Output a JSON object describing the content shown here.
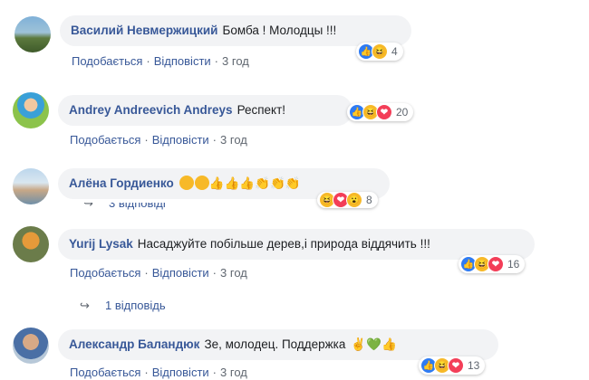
{
  "comments": [
    {
      "author": "Василий Невмержицкий",
      "text": "Бомба ! Молодцы !!!",
      "reaction_count": "4",
      "like_label": "Подобається",
      "reply_label": "Відповісти",
      "time": "3 год",
      "reactions": [
        "like",
        "haha"
      ]
    },
    {
      "author": "Andrey Andreevich Andreys",
      "text": "Респект!",
      "reaction_count": "20",
      "like_label": "Подобається",
      "reply_label": "Відповісти",
      "time": "3 год",
      "reactions": [
        "like",
        "haha",
        "love"
      ]
    },
    {
      "author": "Алёна Гордиенко",
      "text": "",
      "reaction_count": "8",
      "reply_label_partial": "3 відповіді",
      "reactions": [
        "haha",
        "love",
        "haha"
      ]
    },
    {
      "author": "Yurij Lysak",
      "text": "Насаджуйте побільше дерев,і природа віддячить !!!",
      "reaction_count": "16",
      "like_label": "Подобається",
      "reply_label": "Відповісти",
      "time": "3 год",
      "replies_label": "1 відповідь",
      "reactions": [
        "like",
        "haha",
        "love"
      ]
    },
    {
      "author": "Александр Баландюк",
      "text": "Зе, молодец. Поддержка",
      "reaction_count": "13",
      "like_label": "Подобається",
      "reply_label": "Відповісти",
      "time": "3 год",
      "reactions": [
        "like",
        "haha",
        "love"
      ]
    }
  ],
  "colors": {
    "name": "#385898",
    "bubble": "#f2f3f5",
    "meta": "#606770"
  }
}
